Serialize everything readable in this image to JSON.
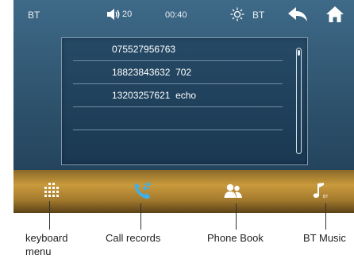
{
  "status_bar": {
    "bt_left": "BT",
    "volume": "20",
    "time": "00:40",
    "bt_right": "BT"
  },
  "contacts": [
    {
      "text": "075527956763"
    },
    {
      "text": "18823843632  702"
    },
    {
      "text": "13203257621  echo"
    },
    {
      "text": ""
    },
    {
      "text": ""
    }
  ],
  "bottom_bar": {
    "items": [
      {
        "name": "keypad",
        "icon": "keypad-icon"
      },
      {
        "name": "call-records",
        "icon": "call-records-icon",
        "accent": "#3fb0e8"
      },
      {
        "name": "phone-book",
        "icon": "phone-book-icon"
      },
      {
        "name": "bt-music",
        "icon": "bt-music-icon"
      }
    ]
  },
  "callouts": {
    "keyboard_menu": "keyboard\nmenu",
    "call_records": "Call records",
    "phone_book": "Phone Book",
    "bt_music": "BT Music"
  },
  "colors": {
    "screen_bg": "#2c4f69",
    "bar_gold": "#c99a3c",
    "accent_blue": "#3fb0e8"
  }
}
